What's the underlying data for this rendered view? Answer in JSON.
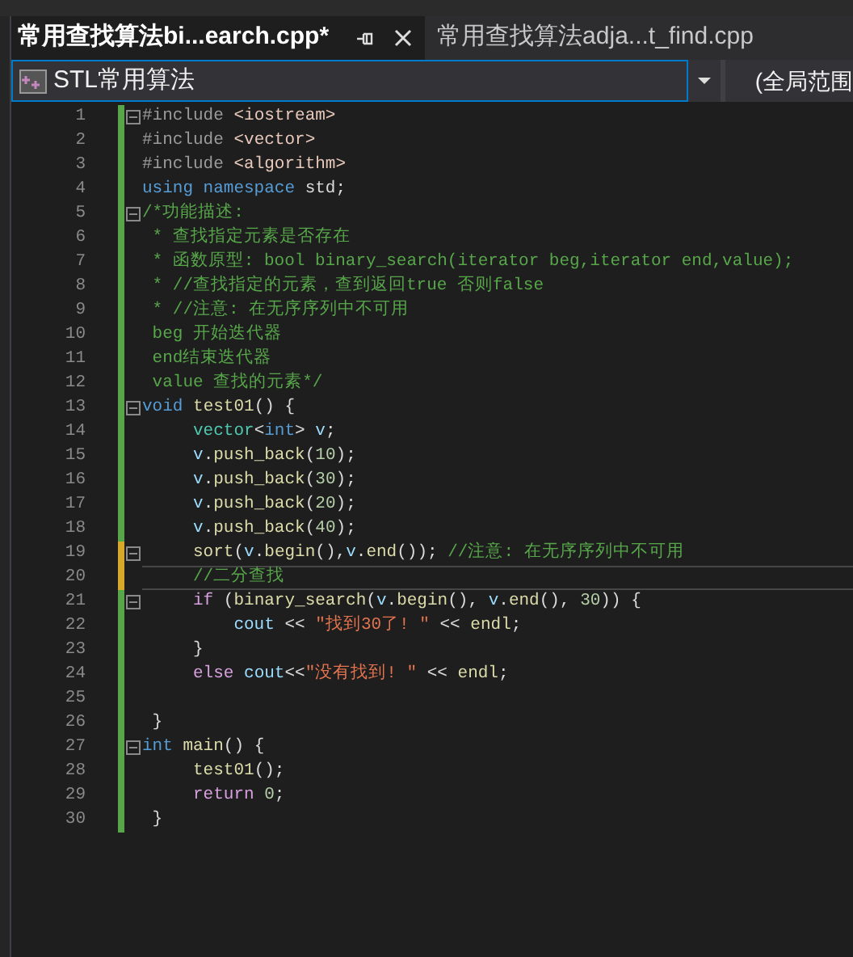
{
  "tabs": [
    {
      "label": "常用查找算法bi...earch.cpp*",
      "selected": true
    },
    {
      "label": "常用查找算法adja...t_find.cpp",
      "selected": false
    }
  ],
  "nav_bar": {
    "project": "STL常用算法",
    "scope": "(全局范围"
  },
  "lines": [
    {
      "number": "1",
      "fold": true,
      "modified": false,
      "selected": false,
      "tokens": [
        {
          "t": "#include",
          "kind": "pp"
        },
        {
          "t": " <iostream>",
          "kind": "inc"
        }
      ]
    },
    {
      "number": "2",
      "fold": false,
      "modified": false,
      "selected": false,
      "tokens": [
        {
          "t": "#include",
          "kind": "pp"
        },
        {
          "t": " <vector>",
          "kind": "inc"
        }
      ]
    },
    {
      "number": "3",
      "fold": false,
      "modified": false,
      "selected": false,
      "tokens": [
        {
          "t": "#include",
          "kind": "pp"
        },
        {
          "t": " <algorithm>",
          "kind": "inc"
        }
      ]
    },
    {
      "number": "4",
      "fold": false,
      "modified": false,
      "selected": false,
      "tokens": [
        {
          "t": "using namespace",
          "kind": "kw"
        },
        {
          "t": " std;",
          "kind": "pl"
        }
      ]
    },
    {
      "number": "5",
      "fold": true,
      "modified": false,
      "selected": false,
      "tokens": [
        {
          "t": "/*功能描述:",
          "kind": "cm"
        }
      ]
    },
    {
      "number": "6",
      "fold": false,
      "modified": false,
      "selected": false,
      "tokens": [
        {
          "t": " * 查找指定元素是否存在",
          "kind": "cm"
        }
      ]
    },
    {
      "number": "7",
      "fold": false,
      "modified": false,
      "selected": false,
      "tokens": [
        {
          "t": " * 函数原型: bool binary_search(iterator beg,iterator end,value);",
          "kind": "cm"
        }
      ]
    },
    {
      "number": "8",
      "fold": false,
      "modified": false,
      "selected": false,
      "tokens": [
        {
          "t": " * //查找指定的元素，查到返回true 否则false",
          "kind": "cm"
        }
      ]
    },
    {
      "number": "9",
      "fold": false,
      "modified": false,
      "selected": false,
      "tokens": [
        {
          "t": " * //注意: 在无序序列中不可用",
          "kind": "cm"
        }
      ]
    },
    {
      "number": "10",
      "fold": false,
      "modified": false,
      "selected": false,
      "tokens": [
        {
          "t": " beg 开始迭代器",
          "kind": "cm"
        }
      ]
    },
    {
      "number": "11",
      "fold": false,
      "modified": false,
      "selected": false,
      "tokens": [
        {
          "t": " end结束迭代器",
          "kind": "cm"
        }
      ]
    },
    {
      "number": "12",
      "fold": false,
      "modified": false,
      "selected": false,
      "tokens": [
        {
          "t": " value 查找的元素*/",
          "kind": "cm"
        }
      ]
    },
    {
      "number": "13",
      "fold": true,
      "modified": false,
      "selected": false,
      "tokens": [
        {
          "t": "void",
          "kind": "kw"
        },
        {
          "t": " test01",
          "kind": "fn"
        },
        {
          "t": "() {",
          "kind": "pl"
        }
      ]
    },
    {
      "number": "14",
      "fold": false,
      "modified": false,
      "selected": false,
      "tokens": [
        {
          "t": "     vector",
          "kind": "ty"
        },
        {
          "t": "<",
          "kind": "pl"
        },
        {
          "t": "int",
          "kind": "kw"
        },
        {
          "t": "> ",
          "kind": "pl"
        },
        {
          "t": "v",
          "kind": "var"
        },
        {
          "t": ";",
          "kind": "pl"
        }
      ]
    },
    {
      "number": "15",
      "fold": false,
      "modified": false,
      "selected": false,
      "tokens": [
        {
          "t": "     v",
          "kind": "var"
        },
        {
          "t": ".",
          "kind": "pl"
        },
        {
          "t": "push_back",
          "kind": "fn"
        },
        {
          "t": "(",
          "kind": "pl"
        },
        {
          "t": "10",
          "kind": "num"
        },
        {
          "t": ");",
          "kind": "pl"
        }
      ]
    },
    {
      "number": "16",
      "fold": false,
      "modified": false,
      "selected": false,
      "tokens": [
        {
          "t": "     v",
          "kind": "var"
        },
        {
          "t": ".",
          "kind": "pl"
        },
        {
          "t": "push_back",
          "kind": "fn"
        },
        {
          "t": "(",
          "kind": "pl"
        },
        {
          "t": "30",
          "kind": "num"
        },
        {
          "t": ");",
          "kind": "pl"
        }
      ]
    },
    {
      "number": "17",
      "fold": false,
      "modified": false,
      "selected": false,
      "tokens": [
        {
          "t": "     v",
          "kind": "var"
        },
        {
          "t": ".",
          "kind": "pl"
        },
        {
          "t": "push_back",
          "kind": "fn"
        },
        {
          "t": "(",
          "kind": "pl"
        },
        {
          "t": "20",
          "kind": "num"
        },
        {
          "t": ");",
          "kind": "pl"
        }
      ]
    },
    {
      "number": "18",
      "fold": false,
      "modified": false,
      "selected": false,
      "tokens": [
        {
          "t": "     v",
          "kind": "var"
        },
        {
          "t": ".",
          "kind": "pl"
        },
        {
          "t": "push_back",
          "kind": "fn"
        },
        {
          "t": "(",
          "kind": "pl"
        },
        {
          "t": "40",
          "kind": "num"
        },
        {
          "t": ");",
          "kind": "pl"
        }
      ]
    },
    {
      "number": "19",
      "fold": true,
      "modified": true,
      "selected": false,
      "tokens": [
        {
          "t": "     sort",
          "kind": "fn"
        },
        {
          "t": "(",
          "kind": "pl"
        },
        {
          "t": "v",
          "kind": "var"
        },
        {
          "t": ".",
          "kind": "pl"
        },
        {
          "t": "begin",
          "kind": "fn"
        },
        {
          "t": "(),",
          "kind": "pl"
        },
        {
          "t": "v",
          "kind": "var"
        },
        {
          "t": ".",
          "kind": "pl"
        },
        {
          "t": "end",
          "kind": "fn"
        },
        {
          "t": "()); ",
          "kind": "pl"
        },
        {
          "t": "//注意: 在无序序列中不可用",
          "kind": "cm"
        }
      ]
    },
    {
      "number": "20",
      "fold": false,
      "modified": true,
      "selected": true,
      "tokens": [
        {
          "t": "     //二分查找",
          "kind": "cm"
        }
      ]
    },
    {
      "number": "21",
      "fold": true,
      "modified": false,
      "selected": false,
      "tokens": [
        {
          "t": "     if",
          "kind": "ctl"
        },
        {
          "t": " (",
          "kind": "pl"
        },
        {
          "t": "binary_search",
          "kind": "fn"
        },
        {
          "t": "(",
          "kind": "pl"
        },
        {
          "t": "v",
          "kind": "var"
        },
        {
          "t": ".",
          "kind": "pl"
        },
        {
          "t": "begin",
          "kind": "fn"
        },
        {
          "t": "(), ",
          "kind": "pl"
        },
        {
          "t": "v",
          "kind": "var"
        },
        {
          "t": ".",
          "kind": "pl"
        },
        {
          "t": "end",
          "kind": "fn"
        },
        {
          "t": "(), ",
          "kind": "pl"
        },
        {
          "t": "30",
          "kind": "num"
        },
        {
          "t": ")) {",
          "kind": "pl"
        }
      ]
    },
    {
      "number": "22",
      "fold": false,
      "modified": false,
      "selected": false,
      "tokens": [
        {
          "t": "         cout",
          "kind": "var"
        },
        {
          "t": " << ",
          "kind": "pl"
        },
        {
          "t": "\"找到30了! \"",
          "kind": "str"
        },
        {
          "t": " << ",
          "kind": "pl"
        },
        {
          "t": "endl",
          "kind": "fn"
        },
        {
          "t": ";",
          "kind": "pl"
        }
      ]
    },
    {
      "number": "23",
      "fold": false,
      "modified": false,
      "selected": false,
      "tokens": [
        {
          "t": "     }",
          "kind": "pl"
        }
      ]
    },
    {
      "number": "24",
      "fold": false,
      "modified": false,
      "selected": false,
      "tokens": [
        {
          "t": "     else",
          "kind": "ctl"
        },
        {
          "t": " cout",
          "kind": "var"
        },
        {
          "t": "<<",
          "kind": "pl"
        },
        {
          "t": "\"没有找到! \"",
          "kind": "str"
        },
        {
          "t": " << ",
          "kind": "pl"
        },
        {
          "t": "endl",
          "kind": "fn"
        },
        {
          "t": ";",
          "kind": "pl"
        }
      ]
    },
    {
      "number": "25",
      "fold": false,
      "modified": false,
      "selected": false
    },
    {
      "number": "26",
      "fold": false,
      "modified": false,
      "selected": false,
      "tokens": [
        {
          "t": " }",
          "kind": "pl"
        }
      ]
    },
    {
      "number": "27",
      "fold": true,
      "modified": false,
      "selected": false,
      "tokens": [
        {
          "t": "int",
          "kind": "kw"
        },
        {
          "t": " main",
          "kind": "fn"
        },
        {
          "t": "() {",
          "kind": "pl"
        }
      ]
    },
    {
      "number": "28",
      "fold": false,
      "modified": false,
      "selected": false,
      "tokens": [
        {
          "t": "     test01",
          "kind": "fn"
        },
        {
          "t": "();",
          "kind": "pl"
        }
      ]
    },
    {
      "number": "29",
      "fold": false,
      "modified": false,
      "selected": false,
      "tokens": [
        {
          "t": "     return",
          "kind": "ctl"
        },
        {
          "t": " 0",
          "kind": "num"
        },
        {
          "t": ";",
          "kind": "pl"
        }
      ]
    },
    {
      "number": "30",
      "fold": false,
      "modified": false,
      "selected": false,
      "tokens": [
        {
          "t": " }",
          "kind": "pl"
        }
      ]
    }
  ]
}
